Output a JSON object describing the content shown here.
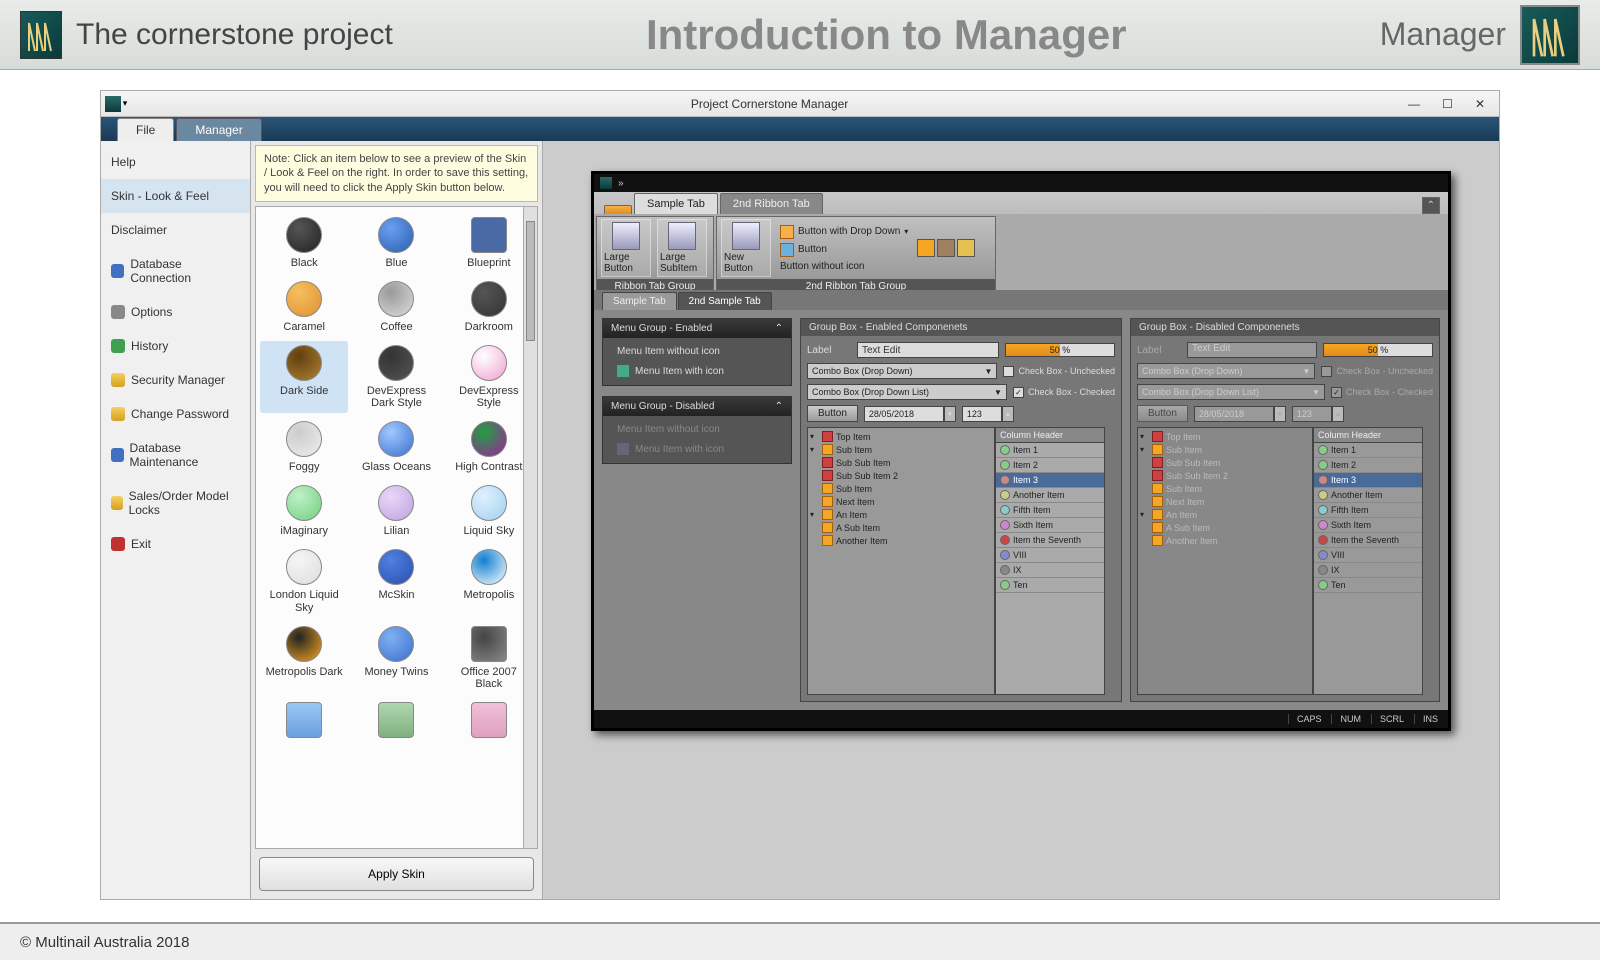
{
  "header": {
    "project": "The cornerstone project",
    "slide_title": "Introduction to Manager",
    "brand": "Manager"
  },
  "footer": {
    "copyright": "© Multinail Australia 2018"
  },
  "window": {
    "title": "Project Cornerstone Manager",
    "tabs": {
      "file": "File",
      "manager": "Manager"
    }
  },
  "sidebar": {
    "help": "Help",
    "skin": "Skin - Look & Feel",
    "disclaimer": "Disclaimer",
    "db_conn": "Database Connection",
    "options": "Options",
    "history": "History",
    "security": "Security Manager",
    "password": "Change Password",
    "db_maint": "Database Maintenance",
    "locks": "Sales/Order Model Locks",
    "exit": "Exit"
  },
  "skin": {
    "note": "Note: Click an item below to see a preview of the Skin / Look & Feel on the right. In order to save this setting, you will need to click the Apply Skin button below.",
    "apply": "Apply Skin",
    "items": [
      {
        "label": "Black",
        "color1": "#222",
        "color2": "#555"
      },
      {
        "label": "Blue",
        "color1": "#2a5fb0",
        "color2": "#6aa0ef"
      },
      {
        "label": "Blueprint",
        "color1": "#4a6aa5",
        "color2": "#4a6aa5"
      },
      {
        "label": "Caramel",
        "color1": "#e09030",
        "color2": "#f5c060"
      },
      {
        "label": "Coffee",
        "color1": "#ddd",
        "color2": "#999"
      },
      {
        "label": "Darkroom",
        "color1": "#333",
        "color2": "#555"
      },
      {
        "label": "Dark Side",
        "color1": "#b08030",
        "color2": "#604010"
      },
      {
        "label": "DevExpress Dark Style",
        "color1": "#555",
        "color2": "#333"
      },
      {
        "label": "DevExpress Style",
        "color1": "#f0a0d0",
        "color2": "#fff"
      },
      {
        "label": "Foggy",
        "color1": "#eee",
        "color2": "#ccc"
      },
      {
        "label": "Glass Oceans",
        "color1": "#3a70d0",
        "color2": "#a0c8ff"
      },
      {
        "label": "High Contrast",
        "color1": "#a020a0",
        "color2": "#20a040"
      },
      {
        "label": "iMaginary",
        "color1": "#70d080",
        "color2": "#c0f0c8"
      },
      {
        "label": "Lilian",
        "color1": "#c0a0e0",
        "color2": "#e8d8f8"
      },
      {
        "label": "Liquid Sky",
        "color1": "#a0d0f0",
        "color2": "#e0f0ff"
      },
      {
        "label": "London Liquid Sky",
        "color1": "#ddd",
        "color2": "#f5f5f5"
      },
      {
        "label": "McSkin",
        "color1": "#2a50b0",
        "color2": "#5080e0"
      },
      {
        "label": "Metropolis",
        "color1": "#ffffff",
        "color2": "#1080d0"
      },
      {
        "label": "Metropolis Dark",
        "color1": "#f5a623",
        "color2": "#222"
      },
      {
        "label": "Money Twins",
        "color1": "#3a70d0",
        "color2": "#80b0f0"
      },
      {
        "label": "Office 2007 Black",
        "color1": "#888",
        "color2": "#444"
      }
    ]
  },
  "preview": {
    "tabs": {
      "sample": "Sample Tab",
      "second": "2nd Ribbon Tab"
    },
    "group1_title": "Ribbon Tab Group",
    "group2_title": "2nd Ribbon Tab Group",
    "large_button": "Large Button",
    "large_subitem": "Large SubItem",
    "new_button": "New Button",
    "btn_dd": "Button with Drop Down",
    "btn": "Button",
    "btn_noicon": "Button without icon",
    "subtabs": {
      "a": "Sample Tab",
      "b": "2nd Sample Tab"
    },
    "menu": {
      "enabled_title": "Menu Group - Enabled",
      "disabled_title": "Menu Group - Disabled",
      "item1": "Menu Item without icon",
      "item2": "Menu Item with icon"
    },
    "gb_enabled": "Group Box - Enabled Componenets",
    "gb_disabled": "Group Box - Disabled Componenets",
    "label": "Label",
    "textedit": "Text Edit",
    "progress": "50 %",
    "combo1": "Combo Box (Drop Down)",
    "combo2": "Combo Box (Drop Down List)",
    "chk_unchecked": "Check Box - Unchecked",
    "chk_checked": "Check Box - Checked",
    "button": "Button",
    "date": "28/05/2018",
    "spin": "123",
    "tree": {
      "top": "Top Item",
      "sub": "Sub Item",
      "subsub": "Sub Sub Item",
      "subsub2": "Sub Sub Item 2",
      "sub2": "Sub Item",
      "next": "Next Item",
      "an": "An Item",
      "asub": "A Sub Item",
      "another": "Another Item"
    },
    "list": {
      "header": "Column Header",
      "items": [
        "Item 1",
        "Item 2",
        "Item 3",
        "Another Item",
        "Fifth Item",
        "Sixth Item",
        "Item the Seventh",
        "VIII",
        "IX",
        "Ten"
      ]
    },
    "status": {
      "caps": "CAPS",
      "num": "NUM",
      "scrl": "SCRL",
      "ins": "INS"
    }
  }
}
